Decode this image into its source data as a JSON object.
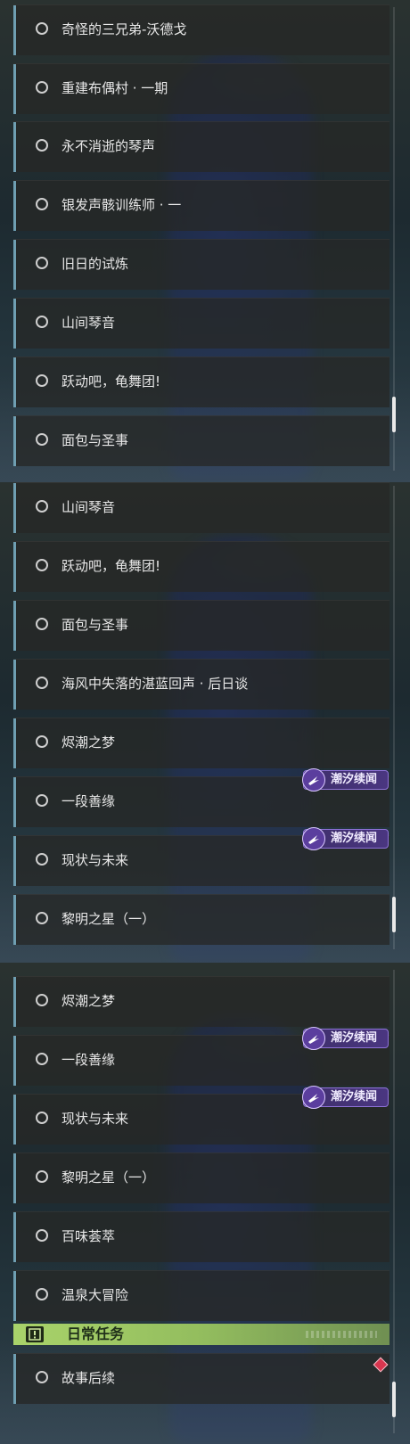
{
  "panels": [
    {
      "quests": [
        {
          "label": "奇怪的三兄弟-沃德戈"
        },
        {
          "label": "重建布偶村 · 一期"
        },
        {
          "label": "永不消逝的琴声"
        },
        {
          "label": "银发声骸训练师 · 一"
        },
        {
          "label": "旧日的试炼"
        },
        {
          "label": "山间琴音"
        },
        {
          "label": "跃动吧，龟舞团!"
        },
        {
          "label": "面包与圣事"
        }
      ]
    },
    {
      "quests": [
        {
          "label": "山间琴音"
        },
        {
          "label": "跃动吧，龟舞团!"
        },
        {
          "label": "面包与圣事"
        },
        {
          "label": "海风中失落的湛蓝回声 · 后日谈"
        },
        {
          "label": "烬潮之梦"
        },
        {
          "label": "一段善缘",
          "badge": "潮汐续闻"
        },
        {
          "label": "现状与未来",
          "badge": "潮汐续闻"
        },
        {
          "label": "黎明之星（一）"
        }
      ]
    },
    {
      "quests": [
        {
          "label": "烬潮之梦"
        },
        {
          "label": "一段善缘",
          "badge": "潮汐续闻"
        },
        {
          "label": "现状与未来",
          "badge": "潮汐续闻"
        },
        {
          "label": "黎明之星（一）"
        },
        {
          "label": "百味荟萃"
        },
        {
          "label": "温泉大冒险"
        }
      ],
      "section": {
        "title": "日常任务",
        "icon": "exclamation-icon"
      },
      "section_quests": [
        {
          "label": "故事后续"
        }
      ]
    }
  ],
  "colors": {
    "row_accent": "#6f9fb2",
    "badge_bg": "#4a3680",
    "section_bg": "#a9d36a"
  }
}
